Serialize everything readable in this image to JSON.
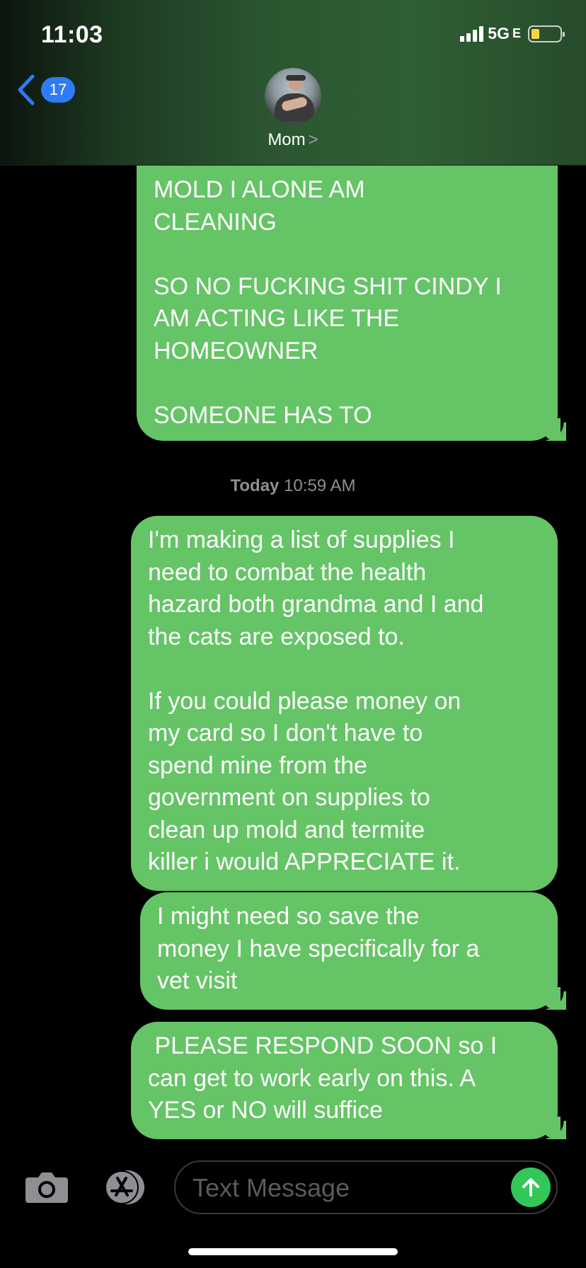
{
  "status_bar": {
    "time": "11:03",
    "network": "5G",
    "network_suffix": "E"
  },
  "header": {
    "back_count": "17",
    "contact_name": "Mom",
    "chevron": ">"
  },
  "timestamp": {
    "day": "Today",
    "time": "10:59 AM"
  },
  "messages": [
    {
      "direction": "sent",
      "text": "MOLD I ALONE AM\nCLEANING\n\nSO NO FUCKING SHIT CINDY I\nAM ACTING LIKE THE\nHOMEOWNER\n\nSOMEONE HAS TO"
    },
    {
      "direction": "sent",
      "text": "I'm making a list of supplies I\nneed to combat the health\nhazard both grandma and I and\nthe cats are exposed to.\n\nIf you could please money on\nmy card so I don't have to\nspend mine from the\ngovernment on supplies to\nclean up mold and termite\nkiller i would APPRECIATE it."
    },
    {
      "direction": "sent",
      "text": "I might need so save the\nmoney I have specifically for a\nvet visit"
    },
    {
      "direction": "sent",
      "text": " PLEASE RESPOND SOON so I\ncan get to work early on this. A\nYES or NO will suffice"
    }
  ],
  "composer": {
    "placeholder": "Text Message"
  },
  "colors": {
    "bubble_green": "#65c466",
    "badge_blue": "#2f7bf5",
    "send_green": "#33c759"
  }
}
